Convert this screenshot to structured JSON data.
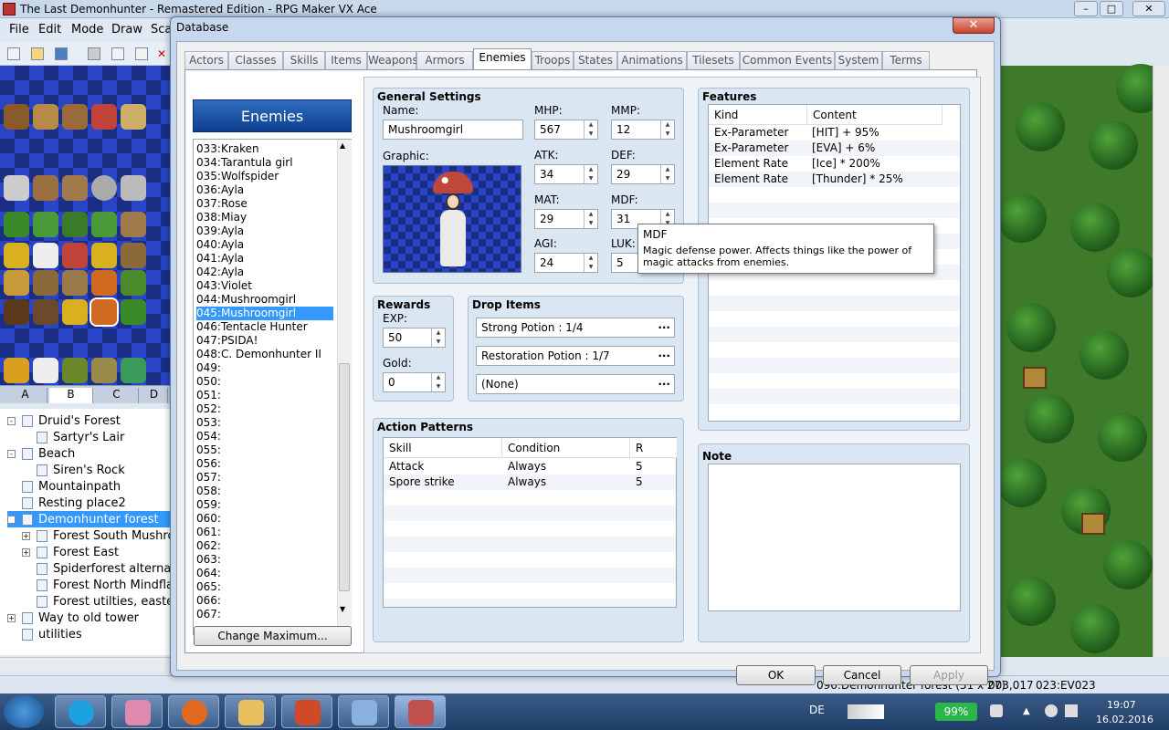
{
  "main_window": {
    "title": "The Last Demonhunter - Remastered Edition - RPG Maker VX Ace",
    "menu": [
      "File",
      "Edit",
      "Mode",
      "Draw",
      "Sca"
    ]
  },
  "tileset_tabs": [
    "A",
    "B",
    "C",
    "D"
  ],
  "map_tree": [
    {
      "label": "Druid's Forest",
      "indent": 0,
      "expander": "-"
    },
    {
      "label": "Sartyr's Lair",
      "indent": 1,
      "expander": ""
    },
    {
      "label": "Beach",
      "indent": 0,
      "expander": "-"
    },
    {
      "label": "Siren's Rock",
      "indent": 1,
      "expander": ""
    },
    {
      "label": "Mountainpath",
      "indent": 0,
      "expander": ""
    },
    {
      "label": "Resting place2",
      "indent": 0,
      "expander": ""
    },
    {
      "label": "Demonhunter forest",
      "indent": 0,
      "expander": "-",
      "selected": true
    },
    {
      "label": "Forest South Mushro",
      "indent": 1,
      "expander": "+"
    },
    {
      "label": "Forest East",
      "indent": 1,
      "expander": "+"
    },
    {
      "label": "Spiderforest alternat",
      "indent": 1,
      "expander": ""
    },
    {
      "label": "Forest North Mindfla",
      "indent": 1,
      "expander": ""
    },
    {
      "label": "Forest utilties, easte",
      "indent": 1,
      "expander": ""
    },
    {
      "label": "Way to old tower",
      "indent": 0,
      "expander": "+"
    },
    {
      "label": "utilities",
      "indent": 0,
      "expander": ""
    }
  ],
  "status_bar": {
    "map": "096:Demonhunter forest (31 x 27)",
    "coords": "003,017",
    "event": "023:EV023"
  },
  "taskbar": {
    "language": "DE",
    "battery": "99%",
    "time": "19:07",
    "date": "16.02.2016"
  },
  "dialog": {
    "title": "Database",
    "close": "✕",
    "tabs": [
      "Actors",
      "Classes",
      "Skills",
      "Items",
      "Weapons",
      "Armors",
      "Enemies",
      "Troops",
      "States",
      "Animations",
      "Tilesets",
      "Common Events",
      "System",
      "Terms"
    ],
    "active_tab": "Enemies",
    "list_header": "Enemies",
    "enemies": [
      "033:Kraken",
      "034:Tarantula girl",
      "035:Wolfspider",
      "036:Ayla",
      "037:Rose",
      "038:Miay",
      "039:Ayla",
      "040:Ayla",
      "041:Ayla",
      "042:Ayla",
      "043:Violet",
      "044:Mushroomgirl",
      "045:Mushroomgirl",
      "046:Tentacle Hunter",
      "047:PSIDA!",
      "048:C. Demonhunter II",
      "049:",
      "050:",
      "051:",
      "052:",
      "053:",
      "054:",
      "055:",
      "056:",
      "057:",
      "058:",
      "059:",
      "060:",
      "061:",
      "062:",
      "063:",
      "064:",
      "065:",
      "066:",
      "067:"
    ],
    "selected_enemy": "045:Mushroomgirl",
    "change_max": "Change Maximum...",
    "general": {
      "title": "General Settings",
      "name_label": "Name:",
      "name": "Mushroomgirl",
      "graphic_label": "Graphic:",
      "stats": [
        {
          "label": "MHP:",
          "value": "567"
        },
        {
          "label": "MMP:",
          "value": "12"
        },
        {
          "label": "ATK:",
          "value": "34"
        },
        {
          "label": "DEF:",
          "value": "29"
        },
        {
          "label": "MAT:",
          "value": "29"
        },
        {
          "label": "MDF:",
          "value": "31"
        },
        {
          "label": "AGI:",
          "value": "24"
        },
        {
          "label": "LUK:",
          "value": "5"
        }
      ]
    },
    "rewards": {
      "title": "Rewards",
      "exp_label": "EXP:",
      "exp": "50",
      "gold_label": "Gold:",
      "gold": "0"
    },
    "drops": {
      "title": "Drop Items",
      "items": [
        "Strong Potion : 1/4",
        "Restoration Potion : 1/7",
        "(None)"
      ]
    },
    "actions": {
      "title": "Action Patterns",
      "headers": [
        "Skill",
        "Condition",
        "R"
      ],
      "rows": [
        [
          "Attack",
          "Always",
          "5"
        ],
        [
          "Spore strike",
          "Always",
          "5"
        ]
      ]
    },
    "features": {
      "title": "Features",
      "headers": [
        "Kind",
        "Content"
      ],
      "rows": [
        [
          "Ex-Parameter",
          "[HIT] + 95%"
        ],
        [
          "Ex-Parameter",
          "[EVA] + 6%"
        ],
        [
          "Element Rate",
          "[Ice] * 200%"
        ],
        [
          "Element Rate",
          "[Thunder] * 25%"
        ]
      ]
    },
    "note": {
      "title": "Note"
    },
    "buttons": {
      "ok": "OK",
      "cancel": "Cancel",
      "apply": "Apply"
    },
    "tooltip": {
      "title": "MDF",
      "text": "Magic defense power. Affects things like the power of magic attacks from enemies."
    }
  }
}
